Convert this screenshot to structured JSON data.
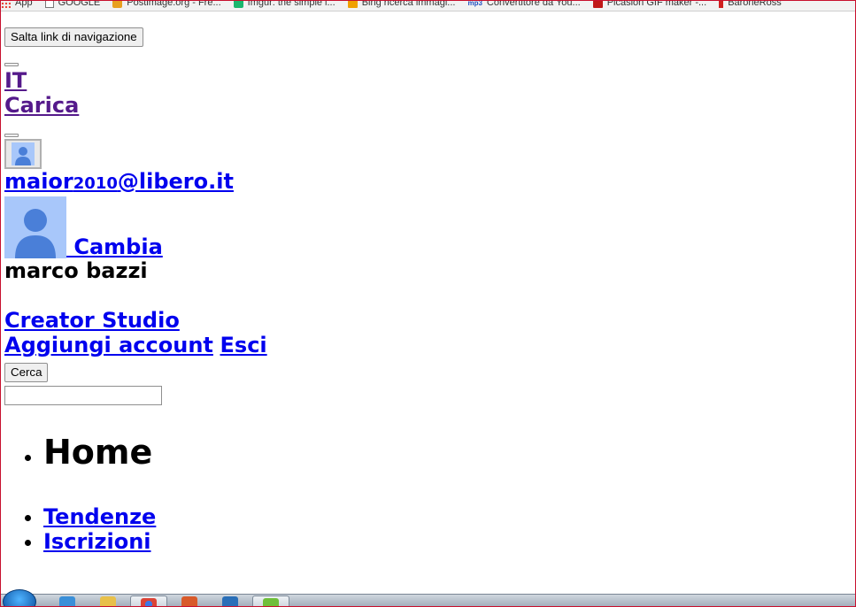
{
  "bookmarks": [
    {
      "icon": "apps-icon",
      "label": "App"
    },
    {
      "icon": "page-icon",
      "label": "GOOGLE"
    },
    {
      "icon": "postimage-icon",
      "label": "Postimage.org - Fre..."
    },
    {
      "icon": "imgur-icon",
      "label": "Imgur: the simple i..."
    },
    {
      "icon": "bing-icon",
      "label": "Bing ricerca immagi..."
    },
    {
      "icon": "mp3-icon",
      "label": "Convertitore da You..."
    },
    {
      "icon": "picasion-icon",
      "label": "Picasion GIF maker -..."
    },
    {
      "icon": "baronerosso-icon",
      "label": "BaroneRoss"
    }
  ],
  "skip_nav_label": "Salta link di navigazione",
  "language_link": "IT",
  "upload_link": "Carica",
  "account": {
    "email_prefix": "maior",
    "email_digits": "2010",
    "email_suffix": "@libero.it",
    "change_link": " Cambia",
    "name": "marco bazzi",
    "creator_studio": "Creator Studio",
    "add_account": "Aggiungi account",
    "logout": "Esci"
  },
  "search": {
    "button_label": "Cerca",
    "value": ""
  },
  "nav": {
    "home": "Home",
    "items": [
      "Tendenze",
      "Iscrizioni"
    ]
  },
  "colors": {
    "link": "#0000ee",
    "visited": "#551a8b",
    "avatar_bg": "#a8c7fa",
    "avatar_fg": "#4a7fd8",
    "frame": "#c8102e"
  }
}
